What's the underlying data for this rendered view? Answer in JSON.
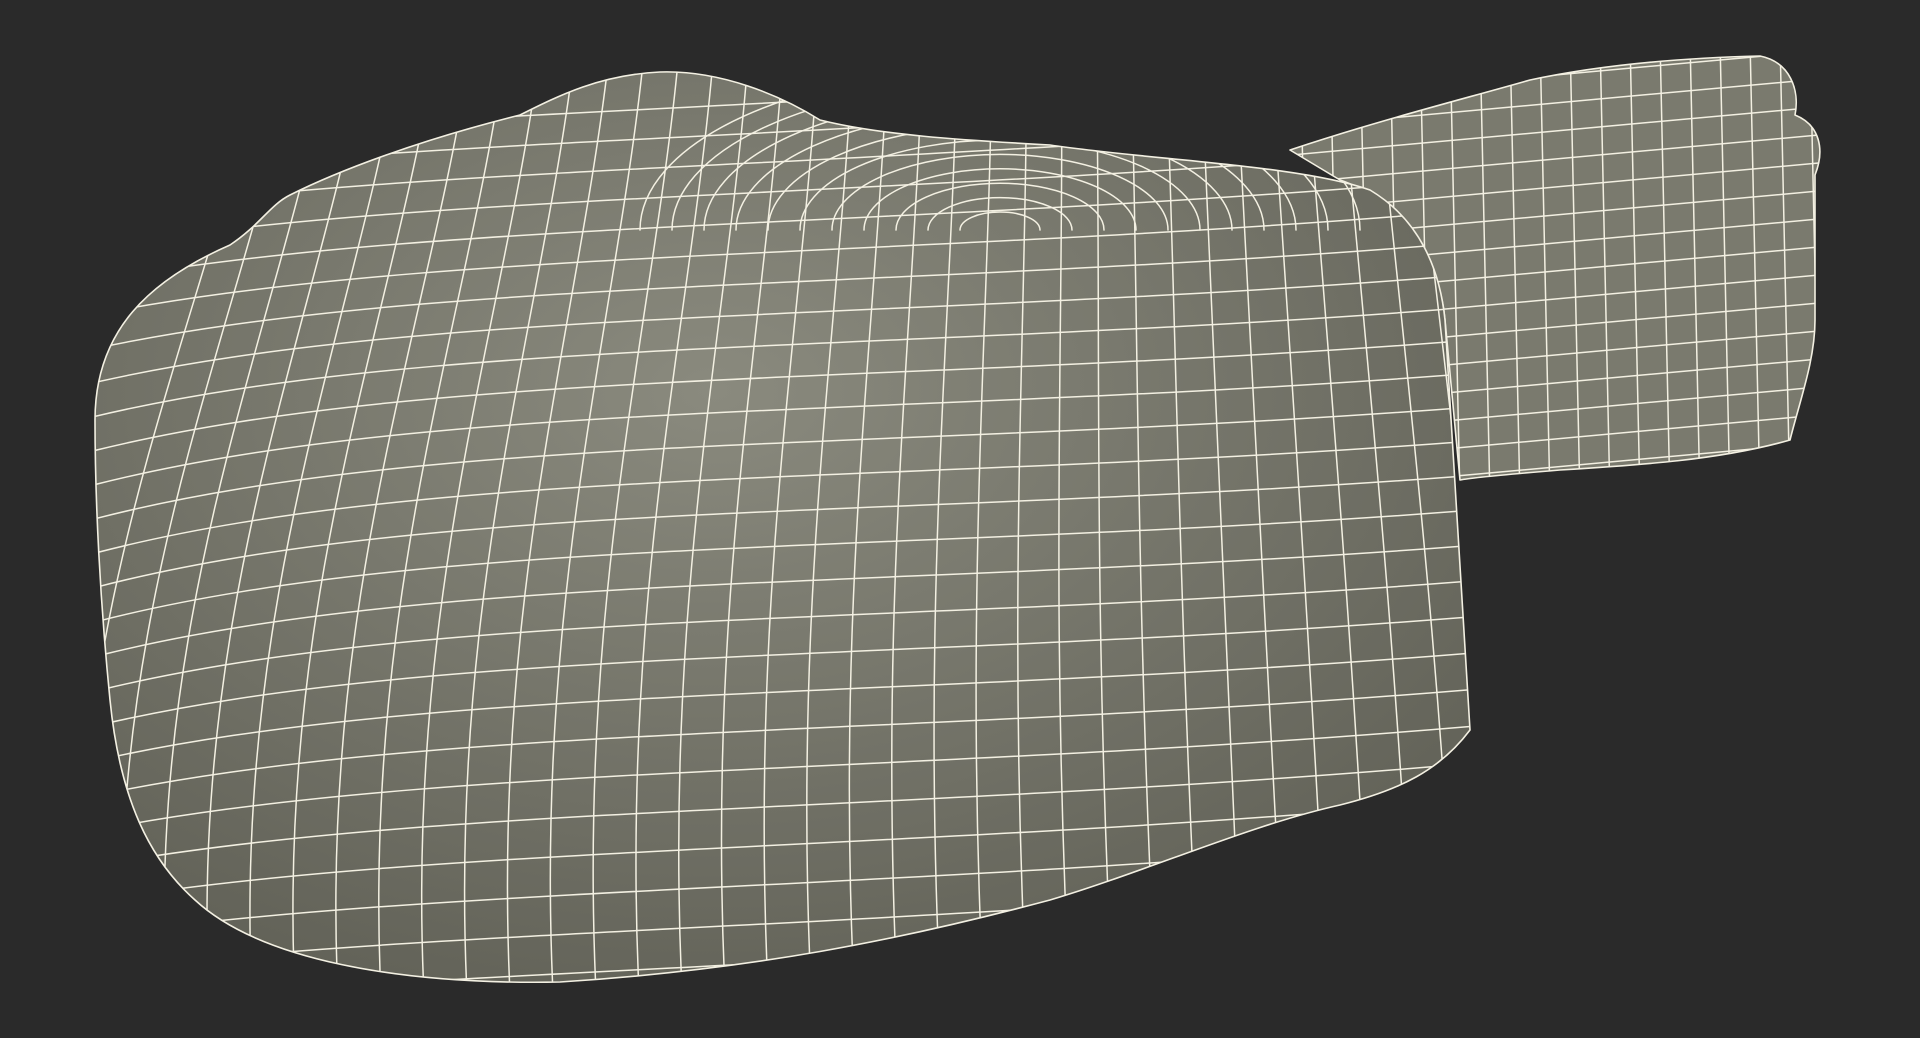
{
  "viewport": {
    "background_color": "#2a2a2a"
  },
  "model": {
    "surface_color": "#7a7a6e",
    "shadow_color": "#5f5f55",
    "highlight_color": "#8a8a7e",
    "wire_color": "#f3f0e2"
  }
}
